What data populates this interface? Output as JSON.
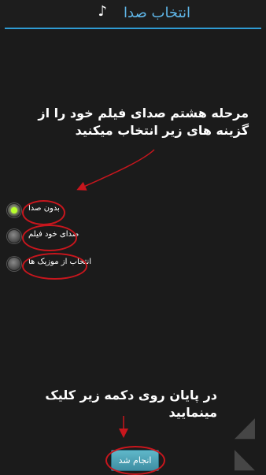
{
  "header": {
    "title": "انتخاب صدا",
    "icon": "music-note-icon",
    "accent_color": "#5fb6e8"
  },
  "instructions": {
    "top": "مرحله هشتم صدای فیلم خود را از گزینه های زیر انتخاب میکنید",
    "bottom": "در پایان روی دکمه زیر کلیک مینمایید"
  },
  "options": [
    {
      "label": "بدون صدا",
      "checked": true
    },
    {
      "label": "صدای خود فیلم",
      "checked": false
    },
    {
      "label": "انتخاب از موزیک ها",
      "checked": false
    }
  ],
  "done_button": {
    "label": "انجام شد"
  },
  "colors": {
    "annotation_red": "#c8161d",
    "selected_radio": "#b7ff2a"
  }
}
